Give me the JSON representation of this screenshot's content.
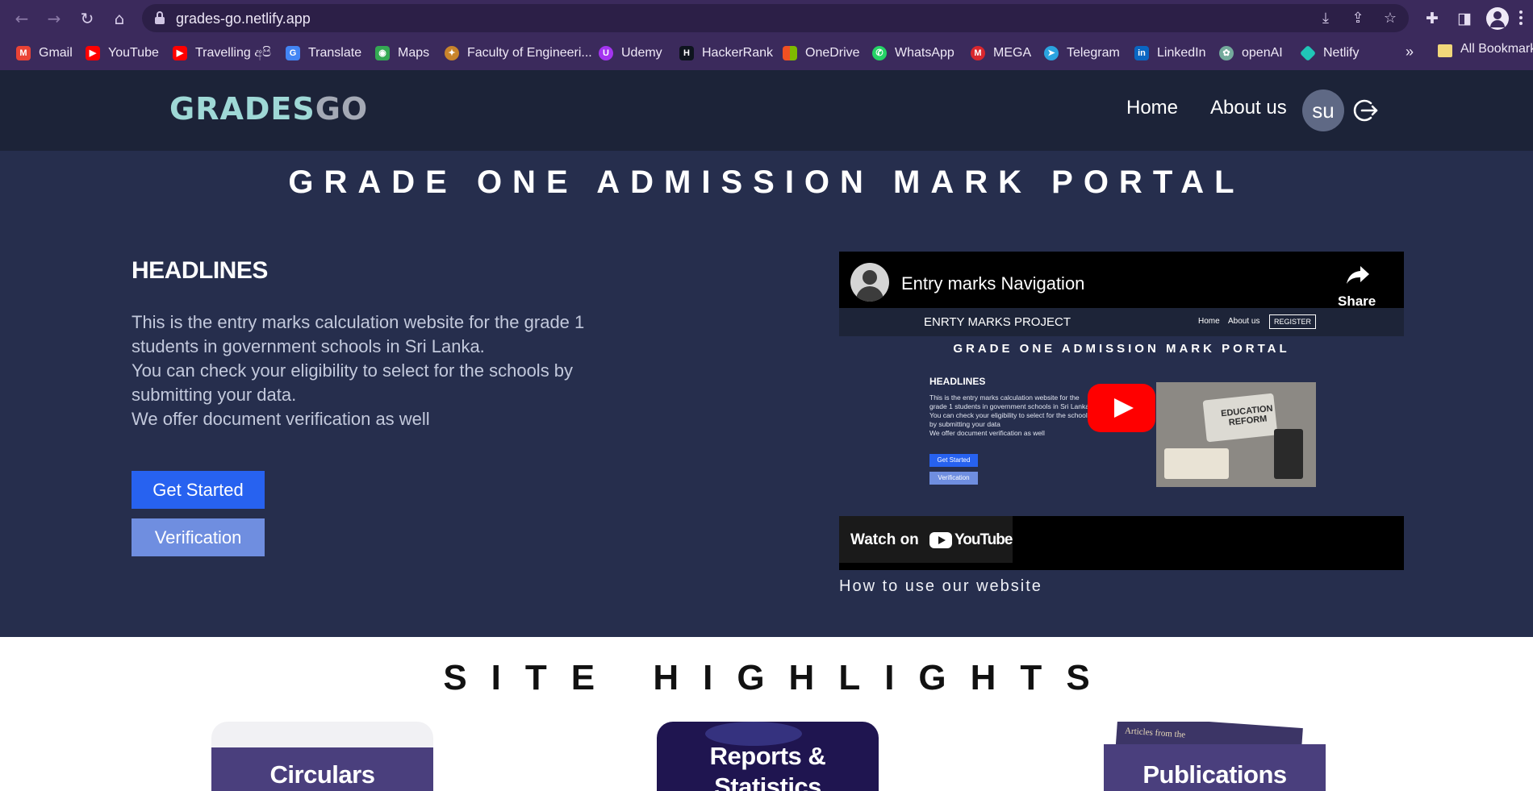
{
  "browser": {
    "url": "grades-go.netlify.app",
    "bookmarks": [
      {
        "label": "Gmail",
        "color": "#ea4335"
      },
      {
        "label": "YouTube",
        "color": "#ff0000"
      },
      {
        "label": "Travelling අපි",
        "color": "#ff0000"
      },
      {
        "label": "Translate",
        "color": "#4285f4"
      },
      {
        "label": "Maps",
        "color": "#34a853"
      },
      {
        "label": "Faculty of Engineeri...",
        "color": "#c8842b"
      },
      {
        "label": "Udemy",
        "color": "#a435f0"
      },
      {
        "label": "HackerRank",
        "color": "#1ba94c"
      },
      {
        "label": "OneDrive",
        "color": "#f25022"
      },
      {
        "label": "WhatsApp",
        "color": "#25d366"
      },
      {
        "label": "MEGA",
        "color": "#d9272e"
      },
      {
        "label": "Telegram",
        "color": "#2aa3df"
      },
      {
        "label": "LinkedIn",
        "color": "#0a66c2"
      },
      {
        "label": "openAI",
        "color": "#74aa9c"
      },
      {
        "label": "Netlify",
        "color": "#20c6b7"
      }
    ],
    "more": "»",
    "all_bookmarks": "All Bookmarks"
  },
  "header": {
    "logo_part1": "GRADES",
    "logo_part2": "GO",
    "nav": {
      "home": "Home",
      "about": "About us"
    },
    "avatar_initials": "su"
  },
  "hero": {
    "title": "GRADE ONE ADMISSION MARK PORTAL",
    "headlines": "HEADLINES",
    "description_lines": [
      "This is the entry marks calculation website for the grade 1",
      "students in government schools in Sri Lanka.",
      "You can check your eligibility to select for the schools by",
      "submitting your data.",
      "We offer document verification as well"
    ],
    "get_started": "Get Started",
    "verification": "Verification"
  },
  "video": {
    "title": "Entry marks Navigation",
    "share": "Share",
    "watch_on": "Watch on",
    "youtube": "YouTube",
    "caption": "How to use our website",
    "thumbnail": {
      "brand": "ENRTY MARKS PROJECT",
      "home": "Home",
      "about": "About us",
      "register": "REGISTER",
      "title": "GRADE ONE ADMISSION MARK PORTAL",
      "headlines": "HEADLINES",
      "desc_lines": [
        "This is the entry marks calculation website for the",
        "grade 1 students in government schools in Sri Lanka",
        "You can check your eligibility to select for the schools",
        "by submitting your data",
        "We offer document verification as well"
      ],
      "get_started": "Get Started",
      "verification": "Verification",
      "image_text": "EDUCATION REFORM"
    }
  },
  "highlights": {
    "title": "SITE HIGHLIGHTS",
    "cards": [
      {
        "label": "Circulars"
      },
      {
        "label": "Reports & Statistics"
      },
      {
        "label": "Publications"
      }
    ],
    "publication_cover_text": "Articles from the"
  },
  "colors": {
    "browser_frame": "#3b2a5c",
    "site_header": "#1c2338",
    "hero_bg": "#262e4d",
    "primary_button": "#2762f0",
    "secondary_button": "#6f8ee0",
    "logo_accent": "#9ed8d6"
  }
}
